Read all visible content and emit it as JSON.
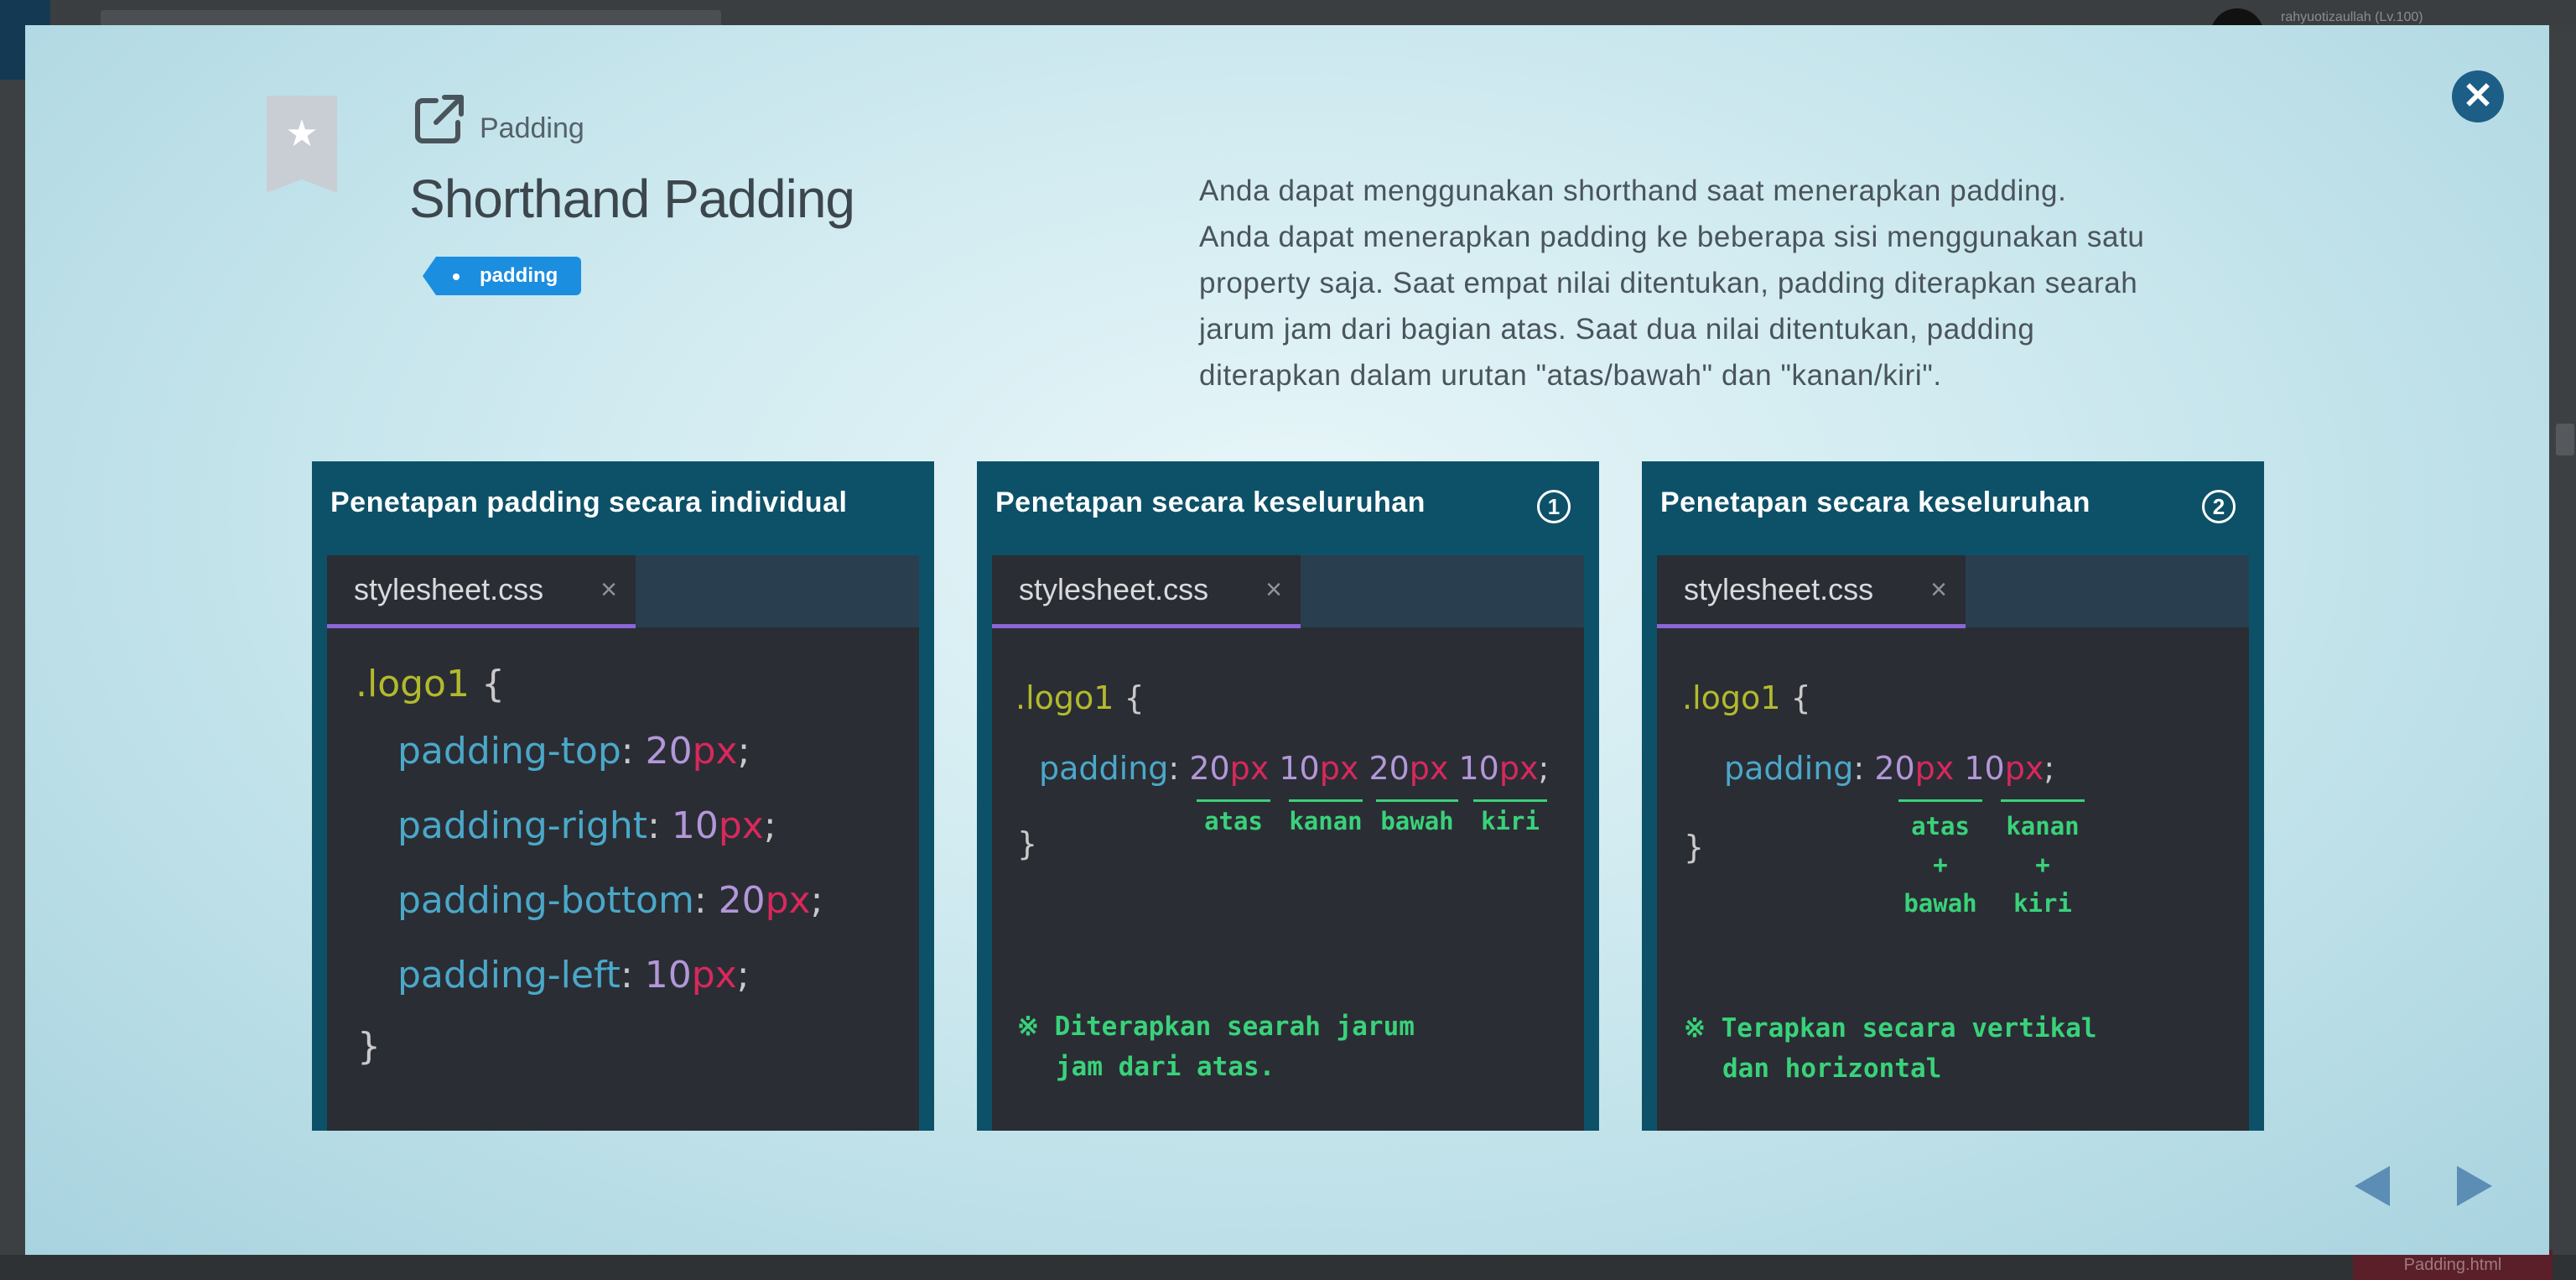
{
  "background": {
    "user_label": "rahyuotizaullah (Lv.100)",
    "bottom_button": "Padding.html"
  },
  "modal": {
    "category": "Padding",
    "title": "Shorthand Padding",
    "tag": "padding",
    "close_icon": "close-icon",
    "bookmark_icon": "star-icon",
    "external_link_icon": "external-link-icon",
    "description_lines": [
      "Anda dapat menggunakan shorthand saat menerapkan padding.",
      "Anda dapat menerapkan padding ke beberapa sisi menggunakan satu",
      "property saja. Saat empat nilai ditentukan, padding diterapkan searah",
      "jarum jam dari bagian atas. Saat dua nilai ditentukan, padding",
      "diterapkan dalam urutan \"atas/bawah\" dan \"kanan/kiri\"."
    ]
  },
  "panels": [
    {
      "title": "Penetapan padding secara individual",
      "tab": "stylesheet.css",
      "tab_close": "×",
      "code": {
        "selector": ".logo1",
        "open": "{",
        "close": "}",
        "lines": [
          {
            "prop": "padding-top",
            "num": "20",
            "unit": "px"
          },
          {
            "prop": "padding-right",
            "num": "10",
            "unit": "px"
          },
          {
            "prop": "padding-bottom",
            "num": "20",
            "unit": "px"
          },
          {
            "prop": "padding-left",
            "num": "10",
            "unit": "px"
          }
        ]
      }
    },
    {
      "title": "Penetapan secara keseluruhan",
      "number": "1",
      "tab": "stylesheet.css",
      "tab_close": "×",
      "code": {
        "selector": ".logo1",
        "open": "{",
        "close": "}",
        "prop": "padding",
        "values": [
          {
            "num": "20",
            "unit": "px",
            "label": "atas"
          },
          {
            "num": "10",
            "unit": "px",
            "label": "kanan"
          },
          {
            "num": "20",
            "unit": "px",
            "label": "bawah"
          },
          {
            "num": "10",
            "unit": "px",
            "label": "kiri"
          }
        ]
      },
      "note_lines": [
        "※ Diterapkan searah jarum",
        "jam dari atas."
      ]
    },
    {
      "title": "Penetapan secara keseluruhan",
      "number": "2",
      "tab": "stylesheet.css",
      "tab_close": "×",
      "code": {
        "selector": ".logo1",
        "open": "{",
        "close": "}",
        "prop": "padding",
        "values": [
          {
            "num": "20",
            "unit": "px",
            "label": "atas",
            "plus": "+",
            "label2": "bawah"
          },
          {
            "num": "10",
            "unit": "px",
            "label": "kanan",
            "plus": "+",
            "label2": "kiri"
          }
        ]
      },
      "note_lines": [
        "※ Terapkan secara vertikal",
        "dan horizontal"
      ]
    }
  ],
  "nav": {
    "prev_icon": "triangle-left-icon",
    "next_icon": "triangle-right-icon"
  },
  "colors": {
    "panel_bg": "#0d5168",
    "editor_bg": "#2b2d34",
    "tag_bg": "#1b8ee0",
    "annotation_green": "#39d27a",
    "selector_yellow": "#b3ba2c",
    "property_blue": "#4aa8c9",
    "number_purple": "#b297d9",
    "unit_red": "#d8285c"
  }
}
